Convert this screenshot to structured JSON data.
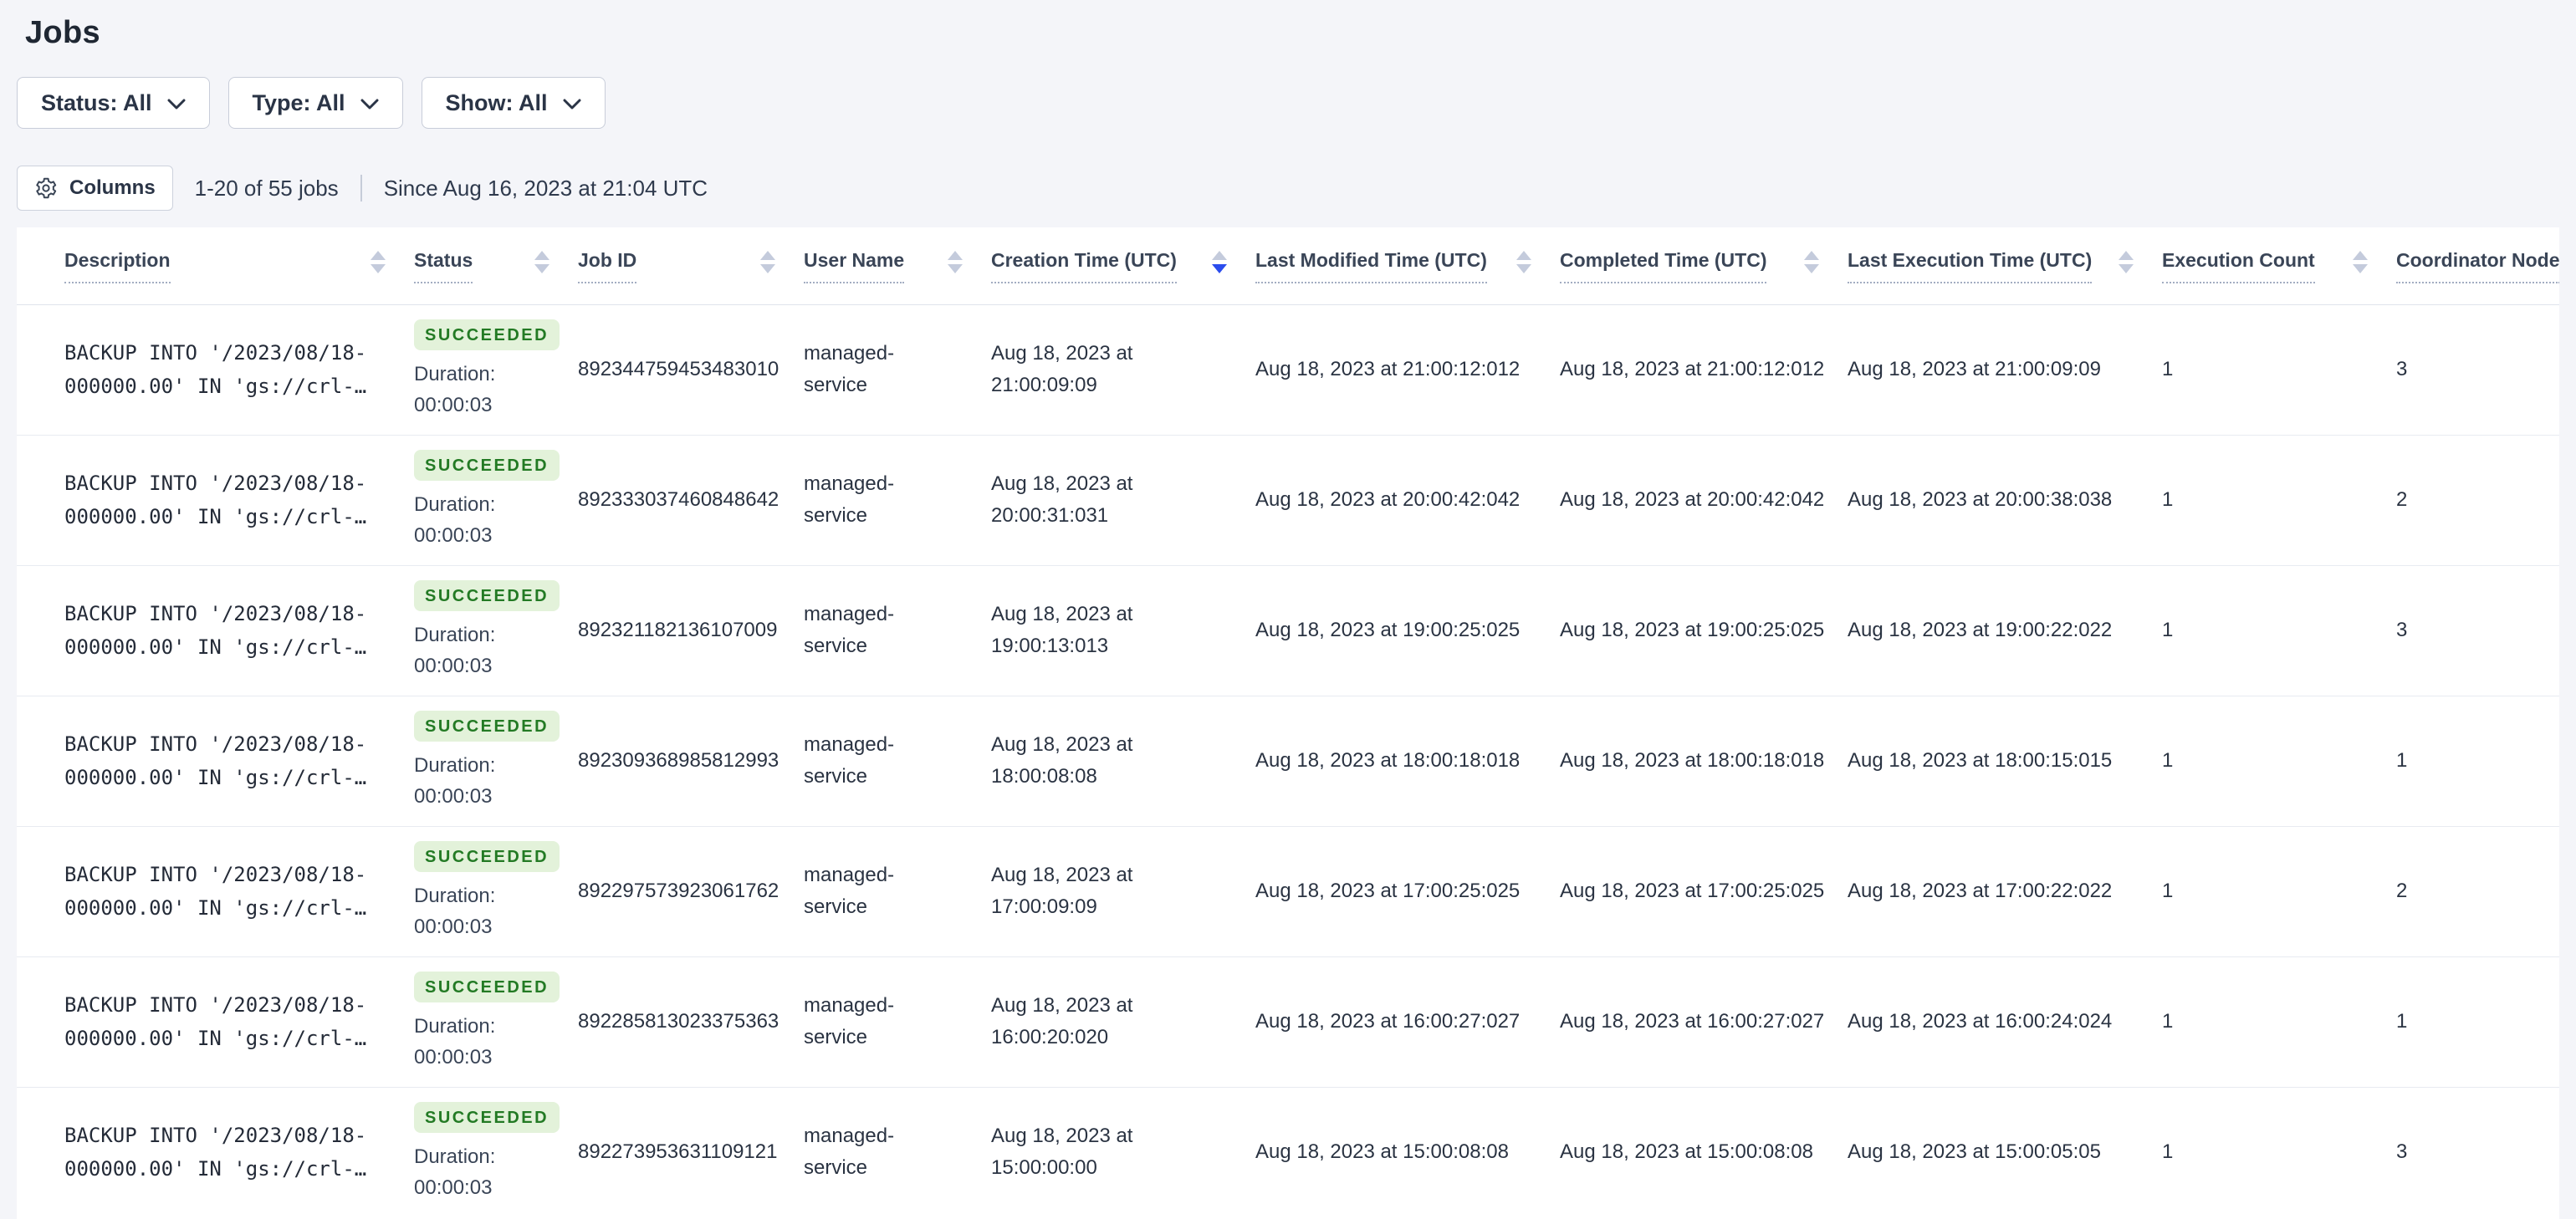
{
  "page": {
    "title": "Jobs"
  },
  "filters": [
    {
      "label": "Status: All"
    },
    {
      "label": "Type: All"
    },
    {
      "label": "Show: All"
    }
  ],
  "toolbar": {
    "columns_label": "Columns",
    "results_count": "1-20 of 55 jobs",
    "since_text": "Since Aug 16, 2023 at 21:04 UTC"
  },
  "table": {
    "columns": [
      {
        "label": "Description",
        "sort": "none"
      },
      {
        "label": "Status",
        "sort": "none"
      },
      {
        "label": "Job ID",
        "sort": "none"
      },
      {
        "label": "User Name",
        "sort": "none"
      },
      {
        "label": "Creation Time (UTC)",
        "sort": "desc"
      },
      {
        "label": "Last Modified Time (UTC)",
        "sort": "none"
      },
      {
        "label": "Completed Time (UTC)",
        "sort": "none"
      },
      {
        "label": "Last Execution Time (UTC)",
        "sort": "none"
      },
      {
        "label": "Execution Count",
        "sort": "none"
      },
      {
        "label": "Coordinator Node",
        "sort": "none"
      }
    ],
    "rows": [
      {
        "description": "BACKUP INTO '/2023/08/18-000000.00' IN 'gs://crl-…",
        "status": "SUCCEEDED",
        "duration_label": "Duration:",
        "duration": "00:00:03",
        "job_id": "892344759453483010",
        "user_name": "managed-service",
        "creation_time": "Aug 18, 2023 at 21:00:09:09",
        "last_modified_time": "Aug 18, 2023 at 21:00:12:012",
        "completed_time": "Aug 18, 2023 at 21:00:12:012",
        "last_execution_time": "Aug 18, 2023 at 21:00:09:09",
        "execution_count": "1",
        "coordinator_node": "3"
      },
      {
        "description": "BACKUP INTO '/2023/08/18-000000.00' IN 'gs://crl-…",
        "status": "SUCCEEDED",
        "duration_label": "Duration:",
        "duration": "00:00:03",
        "job_id": "892333037460848642",
        "user_name": "managed-service",
        "creation_time": "Aug 18, 2023 at 20:00:31:031",
        "last_modified_time": "Aug 18, 2023 at 20:00:42:042",
        "completed_time": "Aug 18, 2023 at 20:00:42:042",
        "last_execution_time": "Aug 18, 2023 at 20:00:38:038",
        "execution_count": "1",
        "coordinator_node": "2"
      },
      {
        "description": "BACKUP INTO '/2023/08/18-000000.00' IN 'gs://crl-…",
        "status": "SUCCEEDED",
        "duration_label": "Duration:",
        "duration": "00:00:03",
        "job_id": "892321182136107009",
        "user_name": "managed-service",
        "creation_time": "Aug 18, 2023 at 19:00:13:013",
        "last_modified_time": "Aug 18, 2023 at 19:00:25:025",
        "completed_time": "Aug 18, 2023 at 19:00:25:025",
        "last_execution_time": "Aug 18, 2023 at 19:00:22:022",
        "execution_count": "1",
        "coordinator_node": "3"
      },
      {
        "description": "BACKUP INTO '/2023/08/18-000000.00' IN 'gs://crl-…",
        "status": "SUCCEEDED",
        "duration_label": "Duration:",
        "duration": "00:00:03",
        "job_id": "892309368985812993",
        "user_name": "managed-service",
        "creation_time": "Aug 18, 2023 at 18:00:08:08",
        "last_modified_time": "Aug 18, 2023 at 18:00:18:018",
        "completed_time": "Aug 18, 2023 at 18:00:18:018",
        "last_execution_time": "Aug 18, 2023 at 18:00:15:015",
        "execution_count": "1",
        "coordinator_node": "1"
      },
      {
        "description": "BACKUP INTO '/2023/08/18-000000.00' IN 'gs://crl-…",
        "status": "SUCCEEDED",
        "duration_label": "Duration:",
        "duration": "00:00:03",
        "job_id": "892297573923061762",
        "user_name": "managed-service",
        "creation_time": "Aug 18, 2023 at 17:00:09:09",
        "last_modified_time": "Aug 18, 2023 at 17:00:25:025",
        "completed_time": "Aug 18, 2023 at 17:00:25:025",
        "last_execution_time": "Aug 18, 2023 at 17:00:22:022",
        "execution_count": "1",
        "coordinator_node": "2"
      },
      {
        "description": "BACKUP INTO '/2023/08/18-000000.00' IN 'gs://crl-…",
        "status": "SUCCEEDED",
        "duration_label": "Duration:",
        "duration": "00:00:03",
        "job_id": "892285813023375363",
        "user_name": "managed-service",
        "creation_time": "Aug 18, 2023 at 16:00:20:020",
        "last_modified_time": "Aug 18, 2023 at 16:00:27:027",
        "completed_time": "Aug 18, 2023 at 16:00:27:027",
        "last_execution_time": "Aug 18, 2023 at 16:00:24:024",
        "execution_count": "1",
        "coordinator_node": "1"
      },
      {
        "description": "BACKUP INTO '/2023/08/18-000000.00' IN 'gs://crl-…",
        "status": "SUCCEEDED",
        "duration_label": "Duration:",
        "duration": "00:00:03",
        "job_id": "892273953631109121",
        "user_name": "managed-service",
        "creation_time": "Aug 18, 2023 at 15:00:00:00",
        "last_modified_time": "Aug 18, 2023 at 15:00:08:08",
        "completed_time": "Aug 18, 2023 at 15:00:08:08",
        "last_execution_time": "Aug 18, 2023 at 15:00:05:05",
        "execution_count": "1",
        "coordinator_node": "3"
      }
    ]
  },
  "icons": {
    "columns_button": "gear-icon",
    "filter_buttons": "chevron-down-icon",
    "column_headers": "sort-arrows-icon"
  },
  "colors": {
    "page_bg": "#f4f5f9",
    "card_bg": "#ffffff",
    "text_primary": "#2a3342",
    "text_header": "#3a4557",
    "succeeded_bg": "#e3f2da",
    "succeeded_text": "#237a24",
    "sort_active": "#2b4ded",
    "sort_inactive": "#c4cbdc",
    "row_divider": "#e8ebf1",
    "border": "#cdd2dd"
  }
}
